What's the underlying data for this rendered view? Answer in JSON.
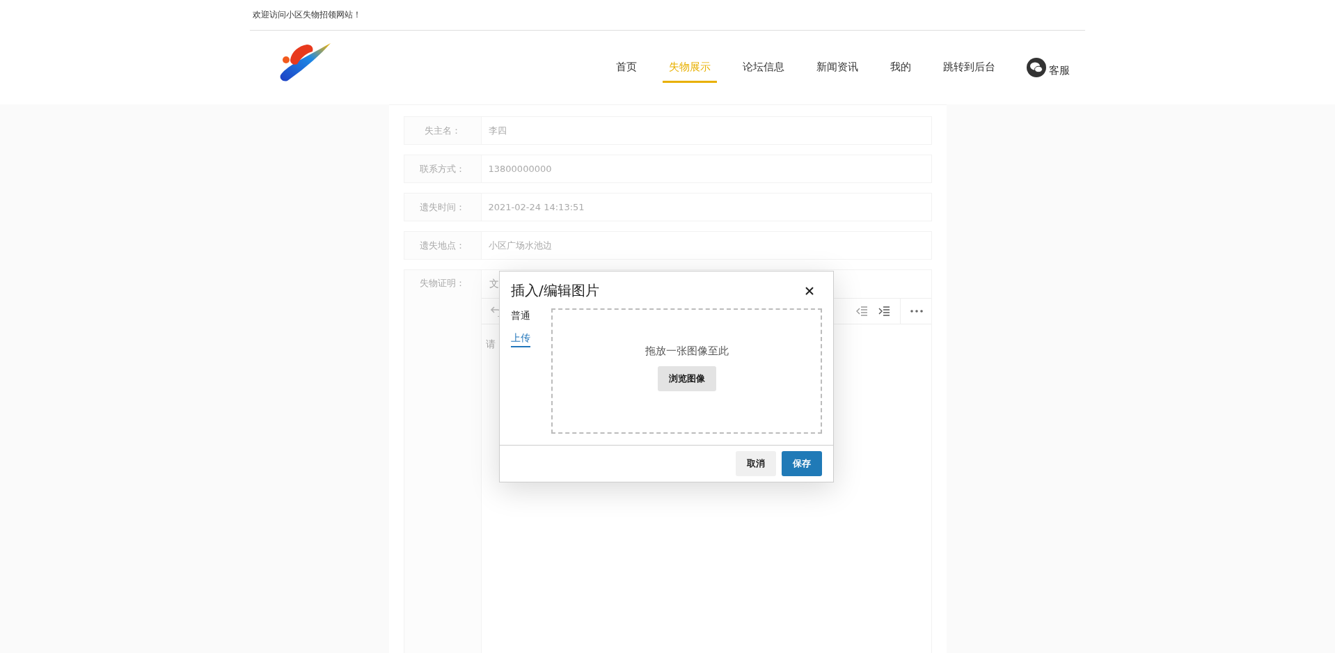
{
  "top_bar": {
    "welcome": "欢迎访问小区失物招领网站！"
  },
  "nav": {
    "items": [
      {
        "label": "首页",
        "selected": false
      },
      {
        "label": "失物展示",
        "selected": true
      },
      {
        "label": "论坛信息",
        "selected": false
      },
      {
        "label": "新闻资讯",
        "selected": false
      },
      {
        "label": "我的",
        "selected": false
      },
      {
        "label": "跳转到后台",
        "selected": false
      }
    ],
    "service": "客服"
  },
  "form": {
    "fields": [
      {
        "label": "失主名：",
        "value": "李四"
      },
      {
        "label": "联系方式：",
        "value": "13800000000"
      },
      {
        "label": "遗失时间：",
        "value": "2021-02-24 14:13:51"
      },
      {
        "label": "遗失地点：",
        "value": "小区广场水池边"
      }
    ],
    "editor": {
      "label": "失物证明：",
      "menubar_text": "文",
      "content_text": "请"
    }
  },
  "dialog": {
    "title": "插入/编辑图片",
    "tabs": [
      {
        "label": "普通",
        "selected": false
      },
      {
        "label": "上传",
        "selected": true
      }
    ],
    "drop_text": "拖放一张图像至此",
    "browse_button": "浏览图像",
    "buttons": [
      {
        "label": "取消",
        "kind": "secondary"
      },
      {
        "label": "保存",
        "kind": "primary"
      }
    ]
  }
}
